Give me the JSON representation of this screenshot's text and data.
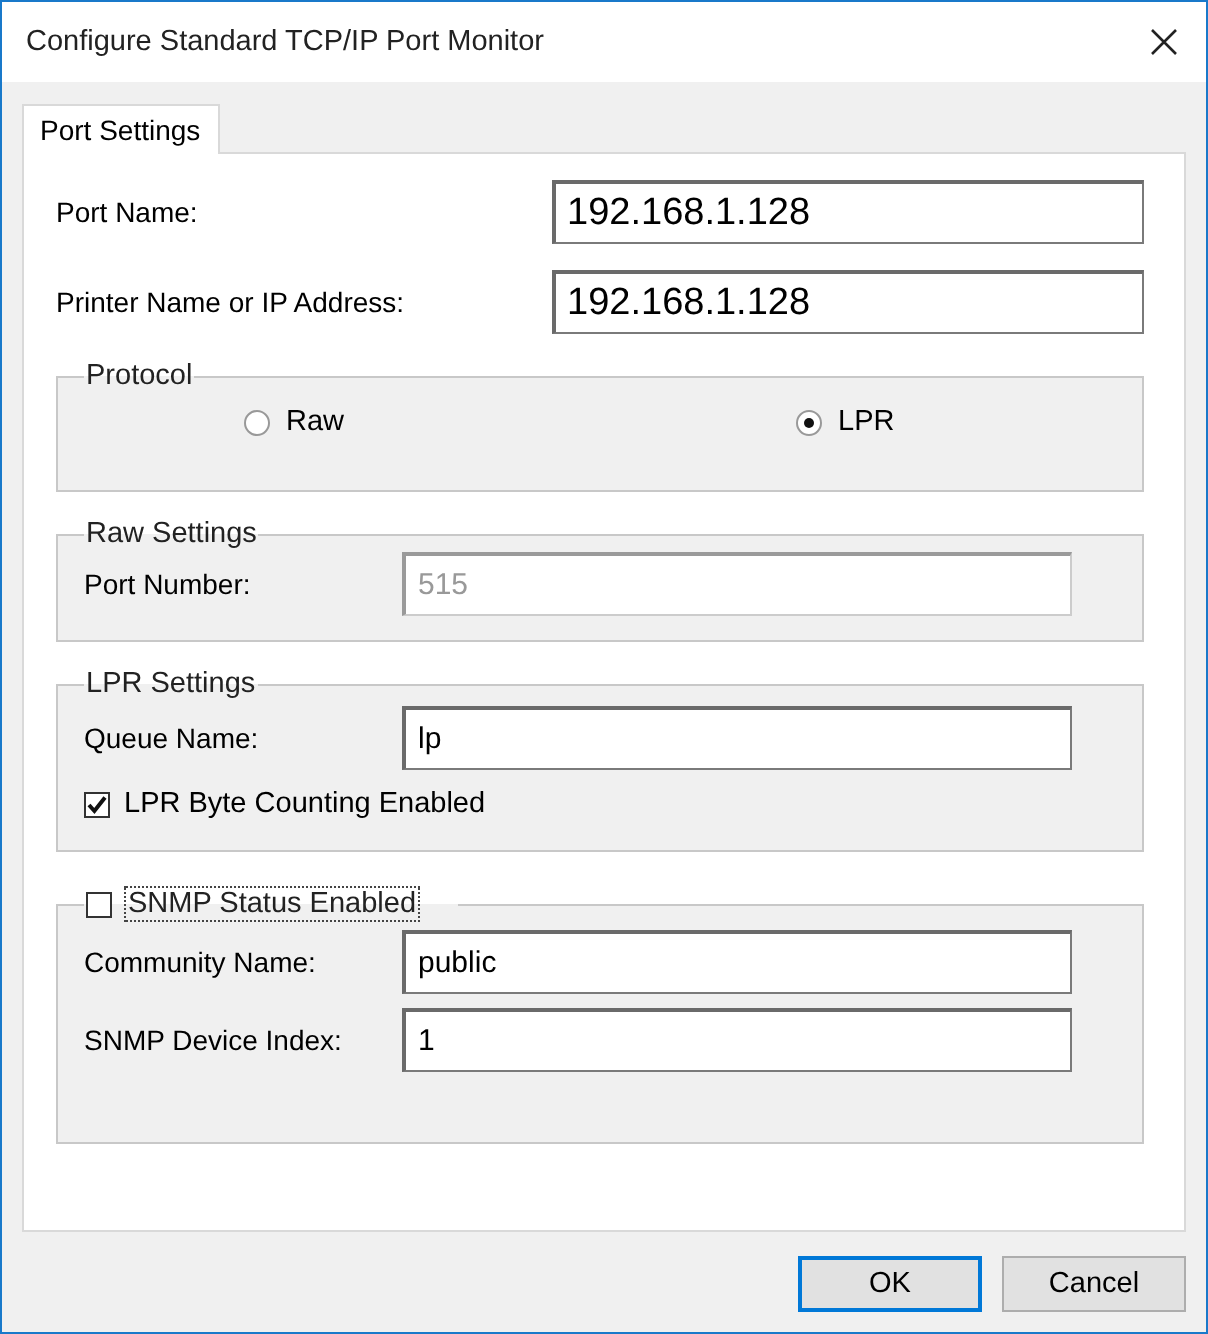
{
  "window": {
    "title": "Configure Standard TCP/IP Port Monitor"
  },
  "tabs": [
    {
      "label": "Port Settings",
      "selected": true
    }
  ],
  "fields": [
    {
      "label": "Port Name:",
      "value": "192.168.1.128"
    },
    {
      "label": "Printer Name or IP Address:",
      "value": "192.168.1.128"
    }
  ],
  "protocol": {
    "title": "Protocol",
    "options": [
      {
        "label": "Raw",
        "selected": false
      },
      {
        "label": "LPR",
        "selected": true
      }
    ]
  },
  "raw_settings": {
    "title": "Raw Settings",
    "fields": [
      {
        "label": "Port Number:",
        "value": "515",
        "disabled": true
      }
    ]
  },
  "lpr_settings": {
    "title": "LPR Settings",
    "fields": [
      {
        "label": "Queue Name:",
        "value": "lp",
        "disabled": false
      }
    ],
    "checkbox": {
      "label": "LPR Byte Counting Enabled",
      "checked": true
    }
  },
  "snmp": {
    "checkbox": {
      "label": "SNMP Status Enabled",
      "checked": false
    },
    "fields": [
      {
        "label": "Community Name:",
        "value": "public",
        "disabled": false
      },
      {
        "label": "SNMP Device Index:",
        "value": "1",
        "disabled": false
      }
    ]
  },
  "buttons": [
    {
      "label": "OK",
      "default": true
    },
    {
      "label": "Cancel",
      "default": false
    }
  ]
}
